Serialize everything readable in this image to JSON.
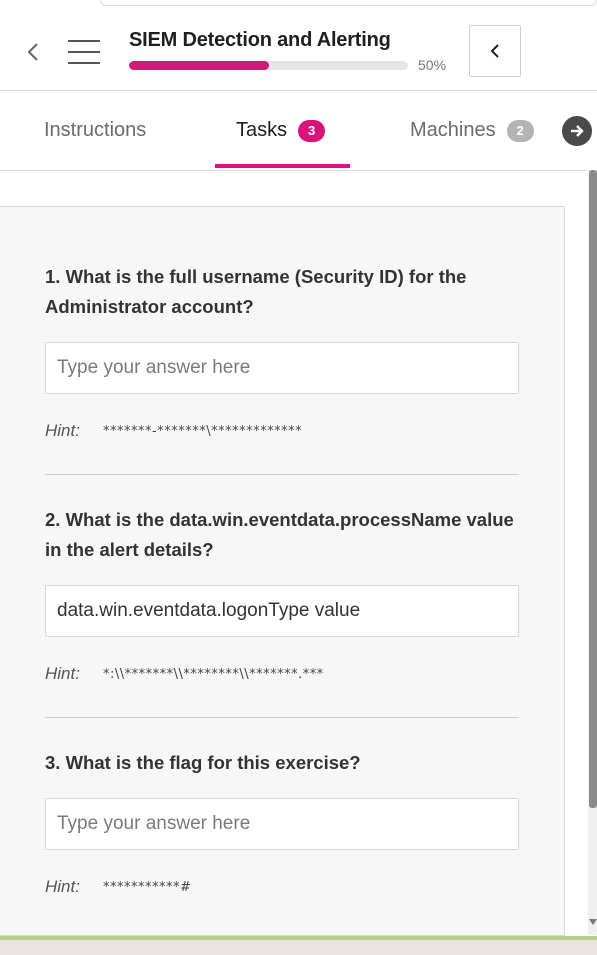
{
  "header": {
    "title": "SIEM Detection and Alerting",
    "progress_text": "50%",
    "progress_fraction": 0.5,
    "accent_color": "#d6147a"
  },
  "tabs": [
    {
      "label": "Instructions",
      "active": false
    },
    {
      "label": "Tasks",
      "badge": "3",
      "active": true,
      "badge_color": "#d6147a"
    },
    {
      "label": "Machines",
      "badge": "2",
      "active": false,
      "badge_color": "#b3b3b3"
    }
  ],
  "icons": {
    "back": "chevron-left-icon",
    "menu": "hamburger-menu-icon",
    "collapse": "chevron-left-icon",
    "next_tab": "arrow-right-circle-icon"
  },
  "questions": [
    {
      "text": "1. What is the full username (Security ID) for the Administrator account?",
      "value": "",
      "placeholder": "Type your answer here",
      "hint_label": "Hint:",
      "hint": "*******-*******\\*************"
    },
    {
      "text": "2. What is the data.win.eventdata.processName value in the alert details?",
      "value": "data.win.eventdata.logonType value",
      "placeholder": "Type your answer here",
      "hint_label": "Hint:",
      "hint": "*:\\\\*******\\\\********\\\\*******.***"
    },
    {
      "text": "3. What is the flag for this exercise?",
      "value": "",
      "placeholder": "Type your answer here",
      "hint_label": "Hint:",
      "hint": "***********#"
    }
  ]
}
